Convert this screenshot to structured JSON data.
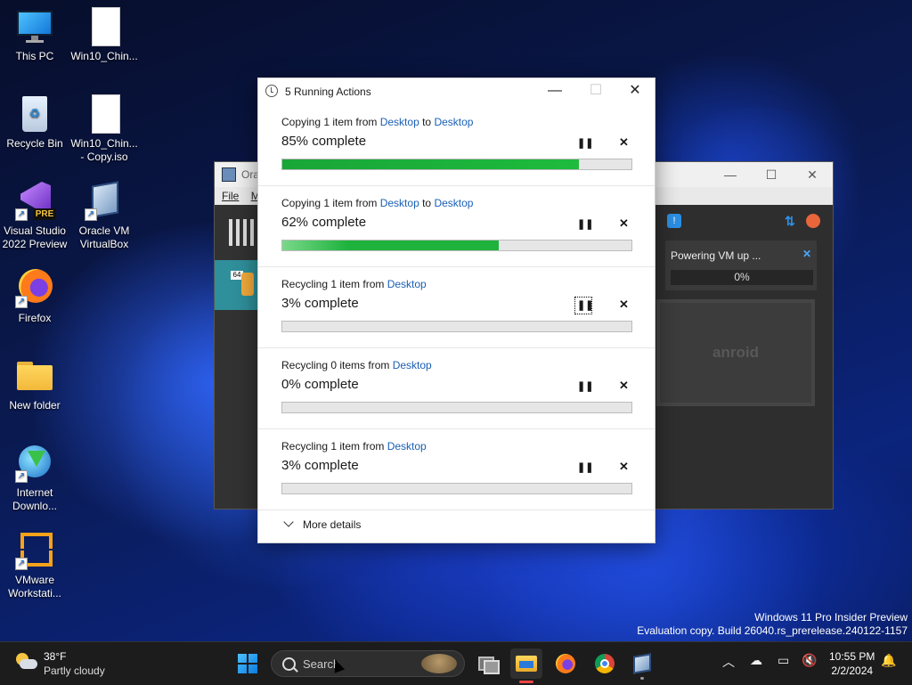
{
  "desktop": {
    "icons": [
      {
        "label": "This PC"
      },
      {
        "label": "Win10_Chin..."
      },
      {
        "label": "Recycle Bin"
      },
      {
        "label": "Win10_Chin... - Copy.iso"
      },
      {
        "label": "Visual Studio 2022 Preview",
        "badge": "PRE"
      },
      {
        "label": "Oracle VM VirtualBox"
      },
      {
        "label": "Firefox"
      },
      {
        "label": "New folder"
      },
      {
        "label": "Internet Downlo..."
      },
      {
        "label": "VMware Workstati..."
      }
    ]
  },
  "virtualbox": {
    "title": "Ora",
    "menu": [
      "File",
      "M"
    ],
    "vm_label": "64",
    "powering": {
      "label": "Powering VM up ...",
      "progress": "0%"
    },
    "preview_text": "anroid"
  },
  "dialog": {
    "title": "5 Running Actions",
    "operations": [
      {
        "prefix": "Copying 1 item from ",
        "src": "Desktop",
        "mid": " to ",
        "dst": "Desktop",
        "status": "85% complete",
        "progress": 0.85
      },
      {
        "prefix": "Copying 1 item from ",
        "src": "Desktop",
        "mid": " to ",
        "dst": "Desktop",
        "status": "62% complete",
        "progress": 0.62
      },
      {
        "prefix": "Recycling 1 item from ",
        "src": "Desktop",
        "mid": "",
        "dst": "",
        "status": "3% complete",
        "progress": 0.0
      },
      {
        "prefix": "Recycling 0 items from ",
        "src": "Desktop",
        "mid": "",
        "dst": "",
        "status": "0% complete",
        "progress": 0.0
      },
      {
        "prefix": "Recycling 1 item from ",
        "src": "Desktop",
        "mid": "",
        "dst": "",
        "status": "3% complete",
        "progress": 0.0
      }
    ],
    "more_details": "More details"
  },
  "watermark": {
    "line1": "Windows 11 Pro Insider Preview",
    "line2": "Evaluation copy. Build 26040.rs_prerelease.240122-1157"
  },
  "taskbar": {
    "weather": {
      "temp": "38°F",
      "condition": "Partly cloudy"
    },
    "search_placeholder": "Search",
    "clock": {
      "time": "10:55 PM",
      "date": "2/2/2024"
    }
  }
}
